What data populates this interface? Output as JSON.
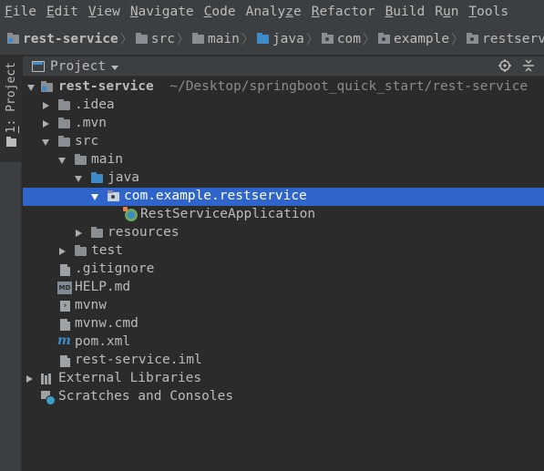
{
  "menubar": {
    "items": [
      {
        "mnemonic": "F",
        "rest": "ile"
      },
      {
        "mnemonic": "E",
        "rest": "dit"
      },
      {
        "mnemonic": "V",
        "rest": "iew"
      },
      {
        "mnemonic": "N",
        "rest": "avigate"
      },
      {
        "mnemonic": "C",
        "rest": "ode"
      },
      {
        "mnemonic": "",
        "rest": "Analyze",
        "pre": "Analy",
        "mn2": "z",
        "post": "e"
      },
      {
        "mnemonic": "R",
        "rest": "efactor"
      },
      {
        "mnemonic": "B",
        "rest": "uild"
      },
      {
        "mnemonic": "",
        "rest": "Run",
        "pre": "R",
        "mn2": "u",
        "post": "n"
      },
      {
        "mnemonic": "T",
        "rest": "ools"
      }
    ]
  },
  "breadcrumbs": [
    "rest-service",
    "src",
    "main",
    "java",
    "com",
    "example",
    "restservice"
  ],
  "side_tab": {
    "number": "1",
    "label": "Project"
  },
  "panel": {
    "title": "Project"
  },
  "tree": {
    "root_label": "rest-service",
    "root_path": "~/Desktop/springboot_quick_start/rest-service",
    "idea": ".idea",
    "mvn": ".mvn",
    "src": "src",
    "main": "main",
    "java": "java",
    "package": "com.example.restservice",
    "app_class": "RestServiceApplication",
    "resources": "resources",
    "test": "test",
    "gitignore": ".gitignore",
    "help": "HELP.md",
    "mvnw": "mvnw",
    "mvnw_cmd": "mvnw.cmd",
    "pom": "pom.xml",
    "iml": "rest-service.iml",
    "external_libraries": "External Libraries",
    "scratches": "Scratches and Consoles",
    "md_badge": "MD",
    "pom_badge": "m"
  }
}
